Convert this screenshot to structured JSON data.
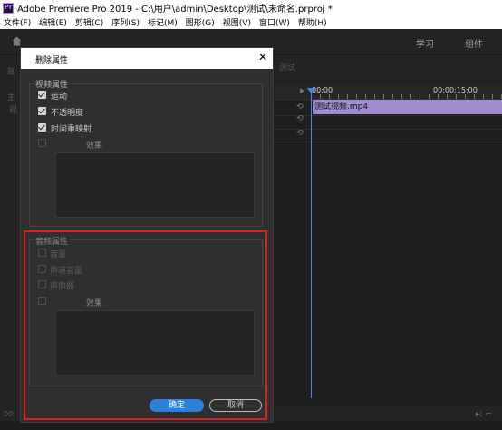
{
  "app": {
    "title": "Adobe Premiere Pro 2019 - C:\\用户\\admin\\Desktop\\测试\\未命名.prproj *",
    "logo_text": "Pr"
  },
  "menu": [
    "文件(F)",
    "编辑(E)",
    "剪辑(C)",
    "序列(S)",
    "标记(M)",
    "图形(G)",
    "视图(V)",
    "窗口(W)",
    "帮助(H)"
  ],
  "workspaces": {
    "learn": "学习",
    "assembly": "组件"
  },
  "timeline": {
    "tab_title": "测试",
    "time_start": "00:00",
    "time_15": "00:00:15:00",
    "clip_name": "测试视频.mp4",
    "playhead_color": "#3b8bea",
    "clip_color": "#a08ad0"
  },
  "background_text": {
    "left_col_1": "主",
    "left_col_2": "视",
    "left_col_3": "效",
    "bottom_left": "00:"
  },
  "dialog": {
    "title": "删除属性",
    "close_icon": "close-icon",
    "video_group": {
      "label": "视频属性",
      "items": [
        {
          "label": "运动",
          "checked": true
        },
        {
          "label": "不透明度",
          "checked": true
        },
        {
          "label": "时间重映射",
          "checked": true
        }
      ],
      "effects_label": "效果",
      "effects_checked": false
    },
    "audio_group": {
      "label": "音频属性",
      "items": [
        {
          "label": "音量",
          "checked": false,
          "enabled": false
        },
        {
          "label": "声道音量",
          "checked": false,
          "enabled": false
        },
        {
          "label": "声像器",
          "checked": false,
          "enabled": false
        }
      ],
      "effects_label": "效果",
      "effects_checked": false
    },
    "ok_label": "确定",
    "cancel_label": "取消",
    "accent_color": "#2e7fd9"
  },
  "annotation_color": "#e02020"
}
